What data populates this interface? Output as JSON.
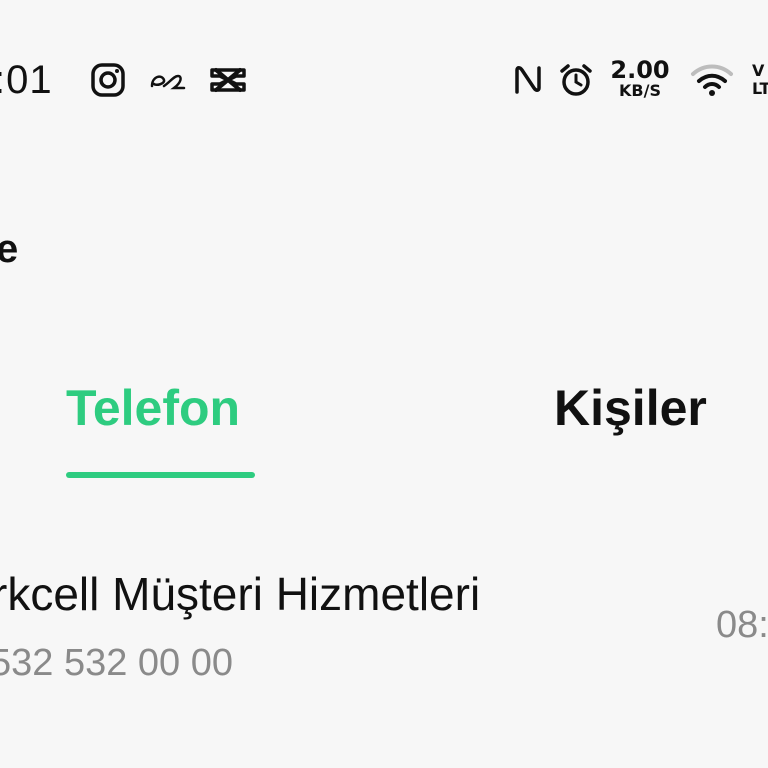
{
  "status_bar": {
    "time": ":01",
    "notification_icons": [
      "instagram-icon",
      "aliexpress-icon",
      "capcut-icon"
    ],
    "system_icons": [
      "nfc-icon",
      "alarm-icon",
      "wifi-icon"
    ],
    "net_speed_value": "2.00",
    "net_speed_unit": "KB/S",
    "volte_top": "V",
    "volte_bottom": "LT"
  },
  "header": {
    "title": "e"
  },
  "tabs": [
    {
      "label": "Telefon",
      "active": true
    },
    {
      "label": "Kişiler",
      "active": false
    }
  ],
  "calls": [
    {
      "name": "rkcell Müşteri Hizmetleri",
      "number": "532 532 00 00",
      "time": "08:"
    }
  ],
  "colors": {
    "accent": "#2ecc80",
    "text": "#111111",
    "secondary_text": "#8a8a8a",
    "background": "#f7f7f7"
  }
}
